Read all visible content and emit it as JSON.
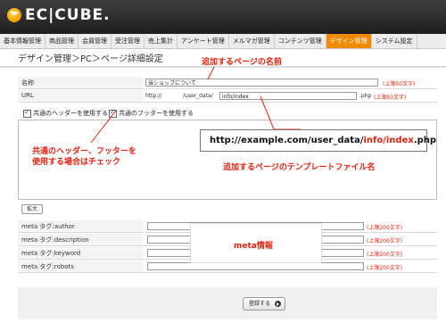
{
  "header": {
    "logo_text": "EC|CUBE."
  },
  "nav": {
    "items": [
      "基本情報管理",
      "商品管理",
      "会員管理",
      "受注管理",
      "売上集計",
      "アンケート管理",
      "メルマガ管理",
      "コンテンツ管理",
      "デザイン管理",
      "システム設定"
    ],
    "active_index": 8
  },
  "breadcrumb": "デザイン管理＞PC＞ページ詳細設定",
  "form": {
    "name_label": "名称",
    "name_value": "当ショップについて",
    "name_limit": "(上限50文字)",
    "url_label": "URL",
    "url_prefix": "http://",
    "url_mid": "/user_data/",
    "url_value": "info/index",
    "url_suffix": ".php",
    "url_limit": "(上限50文字)",
    "use_header_label": "共通のヘッダーを使用する",
    "use_footer_label": "共通のフッターを使用する",
    "expand_label": "拡大"
  },
  "meta": {
    "rows": [
      {
        "label": "meta タグ:author",
        "limit": "(上限200文字)"
      },
      {
        "label": "meta タグ:description",
        "limit": "(上限200文字)"
      },
      {
        "label": "meta タグ:keyword",
        "limit": "(上限200文字)"
      },
      {
        "label": "meta タグ:robots",
        "limit": "(上限200文字)"
      }
    ]
  },
  "annotations": {
    "page_name": "追加するページの名前",
    "checkbox_line1": "共通のヘッダー、フッターを",
    "checkbox_line2": "使用する場合はチェック",
    "url_example_pre": "http://example.com/user_data/",
    "url_example_hl": "info/index",
    "url_example_post": ".php",
    "template_name": "追加するページのテンプレートファイル名",
    "meta_info": "meta情報"
  },
  "submit_label": "登録する",
  "colors": {
    "accent": "#f08a00",
    "annotation": "#e8220f",
    "header": "#2b2b2b"
  }
}
